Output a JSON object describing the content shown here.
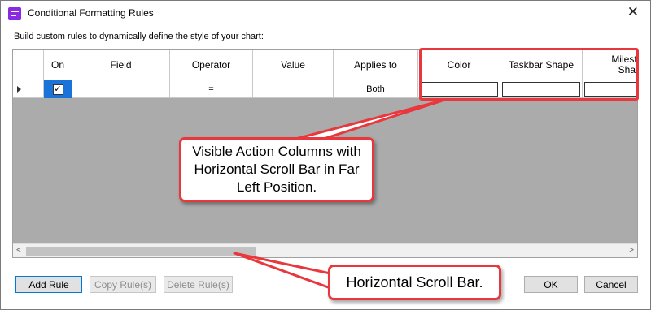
{
  "window": {
    "title": "Conditional Formatting Rules",
    "close_glyph": "✕",
    "app_icon": "conditional-formatting-app-icon"
  },
  "description": "Build custom rules to dynamically define the style of your chart:",
  "grid": {
    "columns": [
      "",
      "On",
      "Field",
      "Operator",
      "Value",
      "Applies to",
      "Color",
      "Taskbar Shape",
      "Milestone Shape"
    ],
    "rows": [
      {
        "on": true,
        "field": "",
        "operator": "=",
        "value": "",
        "applies_to": "Both",
        "color": "",
        "taskbar_shape": "",
        "milestone_shape": ""
      }
    ],
    "selected_on_color": "#1a73d9",
    "empty_area_color": "#ababab",
    "scroll_left_glyph": "<",
    "scroll_right_glyph": ">",
    "scroll_position": "far-left"
  },
  "annotations": {
    "callout_action_columns": "Visible Action Columns with Horizontal Scroll Bar in Far Left Position.",
    "callout_scroll_bar": "Horizontal Scroll Bar.",
    "highlight_color": "#e8383d"
  },
  "buttons": {
    "add_rule": "Add Rule",
    "copy_rules": "Copy Rule(s)",
    "delete_rules": "Delete Rule(s)",
    "ok": "OK",
    "cancel": "Cancel"
  }
}
